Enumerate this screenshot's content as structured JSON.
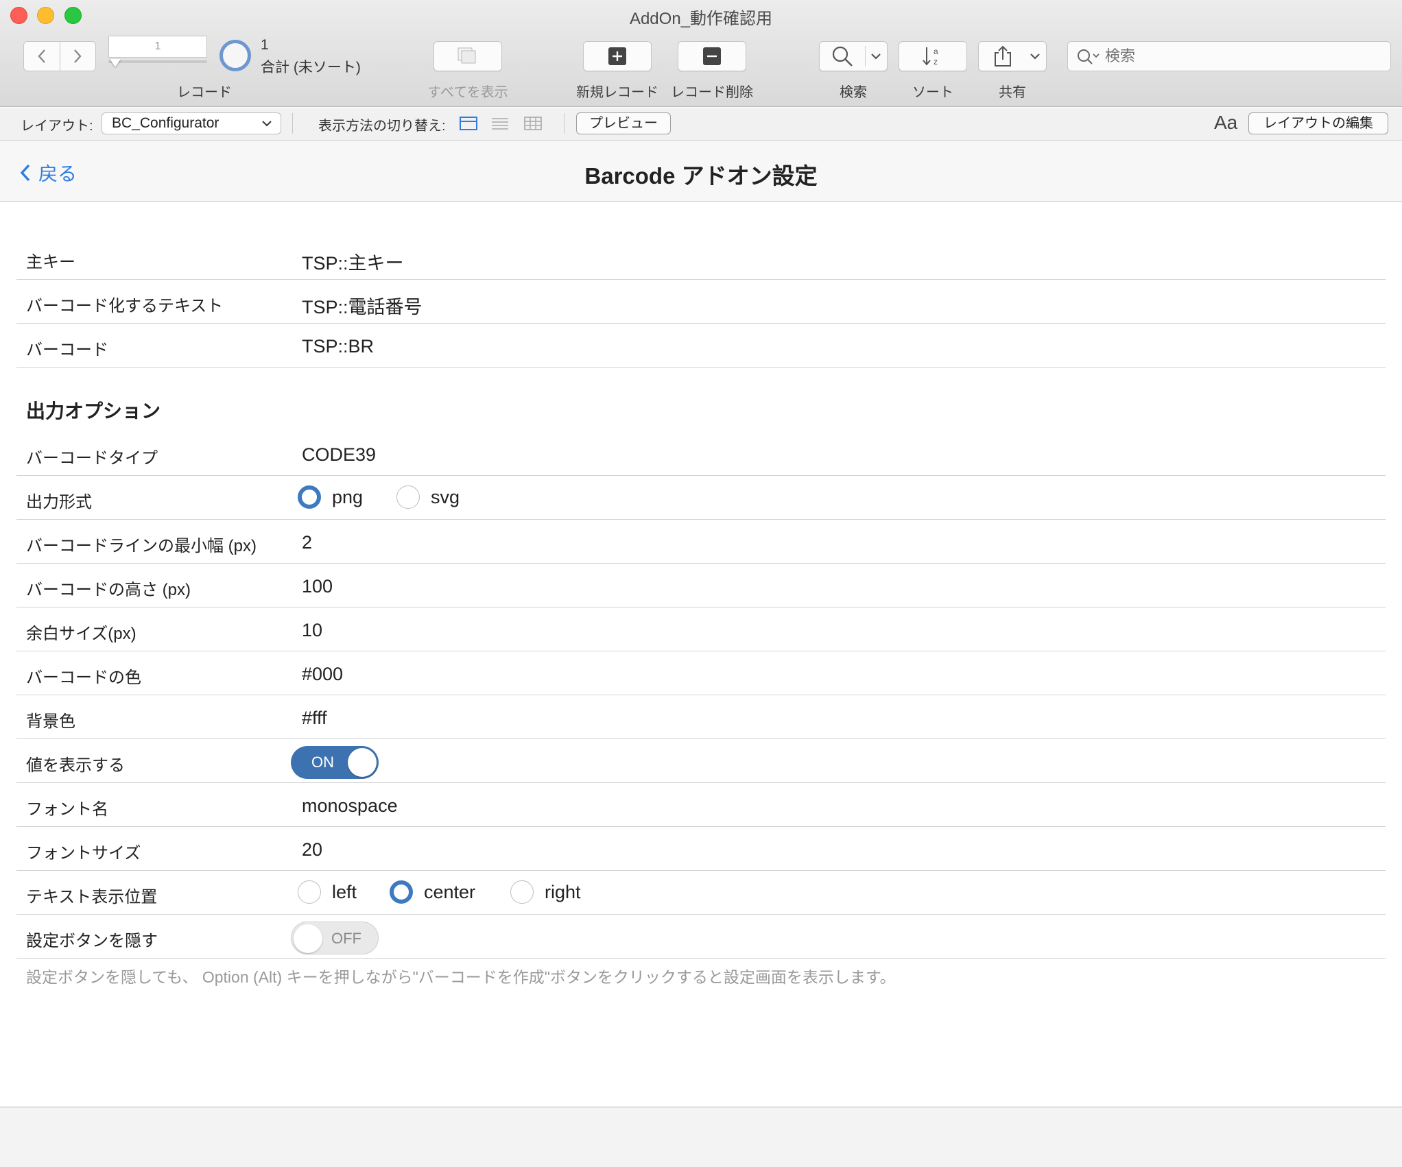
{
  "window": {
    "title": "AddOn_動作確認用"
  },
  "toolbar": {
    "record_number": "1",
    "record_label": "レコード",
    "record_count": "1",
    "record_total": "合計 (未ソート)",
    "show_all": "すべてを表示",
    "new_record": "新規レコード",
    "delete_record": "レコード削除",
    "find": "検索",
    "sort": "ソート",
    "share": "共有",
    "search_placeholder": "検索"
  },
  "layout_bar": {
    "layout_label": "レイアウト:",
    "layout_value": "BC_Configurator",
    "view_switch_label": "表示方法の切り替え:",
    "preview": "プレビュー",
    "font_size_icon": "Aa",
    "edit_layout": "レイアウトの編集"
  },
  "header": {
    "back": "戻る",
    "title": "Barcode アドオン設定"
  },
  "fields": [
    {
      "label": "主キー",
      "value": "TSP::主キー"
    },
    {
      "label": "バーコード化するテキスト",
      "value": "TSP::電話番号"
    },
    {
      "label": "バーコード",
      "value": "TSP::BR"
    }
  ],
  "options": {
    "section_title": "出力オプション",
    "barcode_type": {
      "label": "バーコードタイプ",
      "value": "CODE39"
    },
    "output_format": {
      "label": "出力形式",
      "options": [
        "png",
        "svg"
      ],
      "selected": "png"
    },
    "min_width": {
      "label": "バーコードラインの最小幅 (px)",
      "value": "2"
    },
    "height": {
      "label": "バーコードの高さ (px)",
      "value": "100"
    },
    "margin": {
      "label": "余白サイズ(px)",
      "value": "10"
    },
    "color": {
      "label": "バーコードの色",
      "value": "#000"
    },
    "background": {
      "label": "背景色",
      "value": "#fff"
    },
    "display_value": {
      "label": "値を表示する",
      "state": "ON"
    },
    "font": {
      "label": "フォント名",
      "value": "monospace"
    },
    "font_size": {
      "label": "フォントサイズ",
      "value": "20"
    },
    "text_align": {
      "label": "テキスト表示位置",
      "options": [
        "left",
        "center",
        "right"
      ],
      "selected": "center"
    },
    "hide_settings": {
      "label": "設定ボタンを隠す",
      "state": "OFF"
    }
  },
  "note": "設定ボタンを隠しても、 Option (Alt) キーを押しながら\"バーコードを作成\"ボタンをクリックすると設定画面を表示します。",
  "colors": {
    "accent": "#3d7ac0",
    "link": "#2f7de1",
    "toggle_on": "#3d72b0"
  }
}
